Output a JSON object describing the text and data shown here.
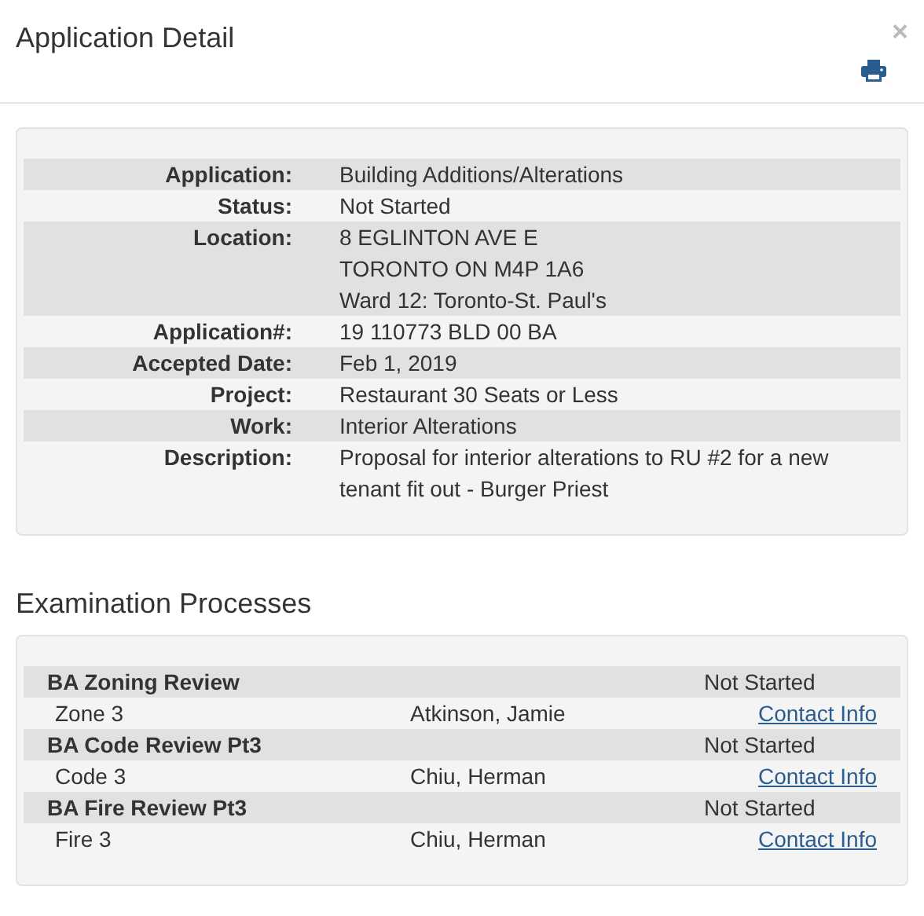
{
  "dialog": {
    "title": "Application Detail",
    "close": "×"
  },
  "details": [
    {
      "label": "Application:",
      "lines": [
        "Building Additions/Alterations"
      ]
    },
    {
      "label": "Status:",
      "lines": [
        "Not Started"
      ]
    },
    {
      "label": "Location:",
      "lines": [
        "8 EGLINTON AVE E",
        "TORONTO ON M4P 1A6",
        "Ward 12: Toronto-St. Paul's"
      ]
    },
    {
      "label": "Application#:",
      "lines": [
        "19 110773 BLD 00 BA"
      ]
    },
    {
      "label": "Accepted Date:",
      "lines": [
        "Feb 1, 2019"
      ]
    },
    {
      "label": "Project:",
      "lines": [
        "Restaurant 30 Seats or Less"
      ]
    },
    {
      "label": "Work:",
      "lines": [
        "Interior Alterations"
      ]
    },
    {
      "label": "Description:",
      "lines": [
        "Proposal for interior alterations to RU #2 for a new",
        "tenant fit out - Burger Priest"
      ]
    }
  ],
  "examination": {
    "heading": "Examination Processes",
    "processes": [
      {
        "name": "BA Zoning Review",
        "status": "Not Started",
        "unit": "Zone 3",
        "examiner": "Atkinson, Jamie",
        "link": "Contact Info"
      },
      {
        "name": "BA Code Review Pt3",
        "status": "Not Started",
        "unit": "Code 3",
        "examiner": "Chiu, Herman",
        "link": "Contact Info"
      },
      {
        "name": "BA Fire Review Pt3",
        "status": "Not Started",
        "unit": "Fire 3",
        "examiner": "Chiu, Herman",
        "link": "Contact Info"
      }
    ]
  }
}
